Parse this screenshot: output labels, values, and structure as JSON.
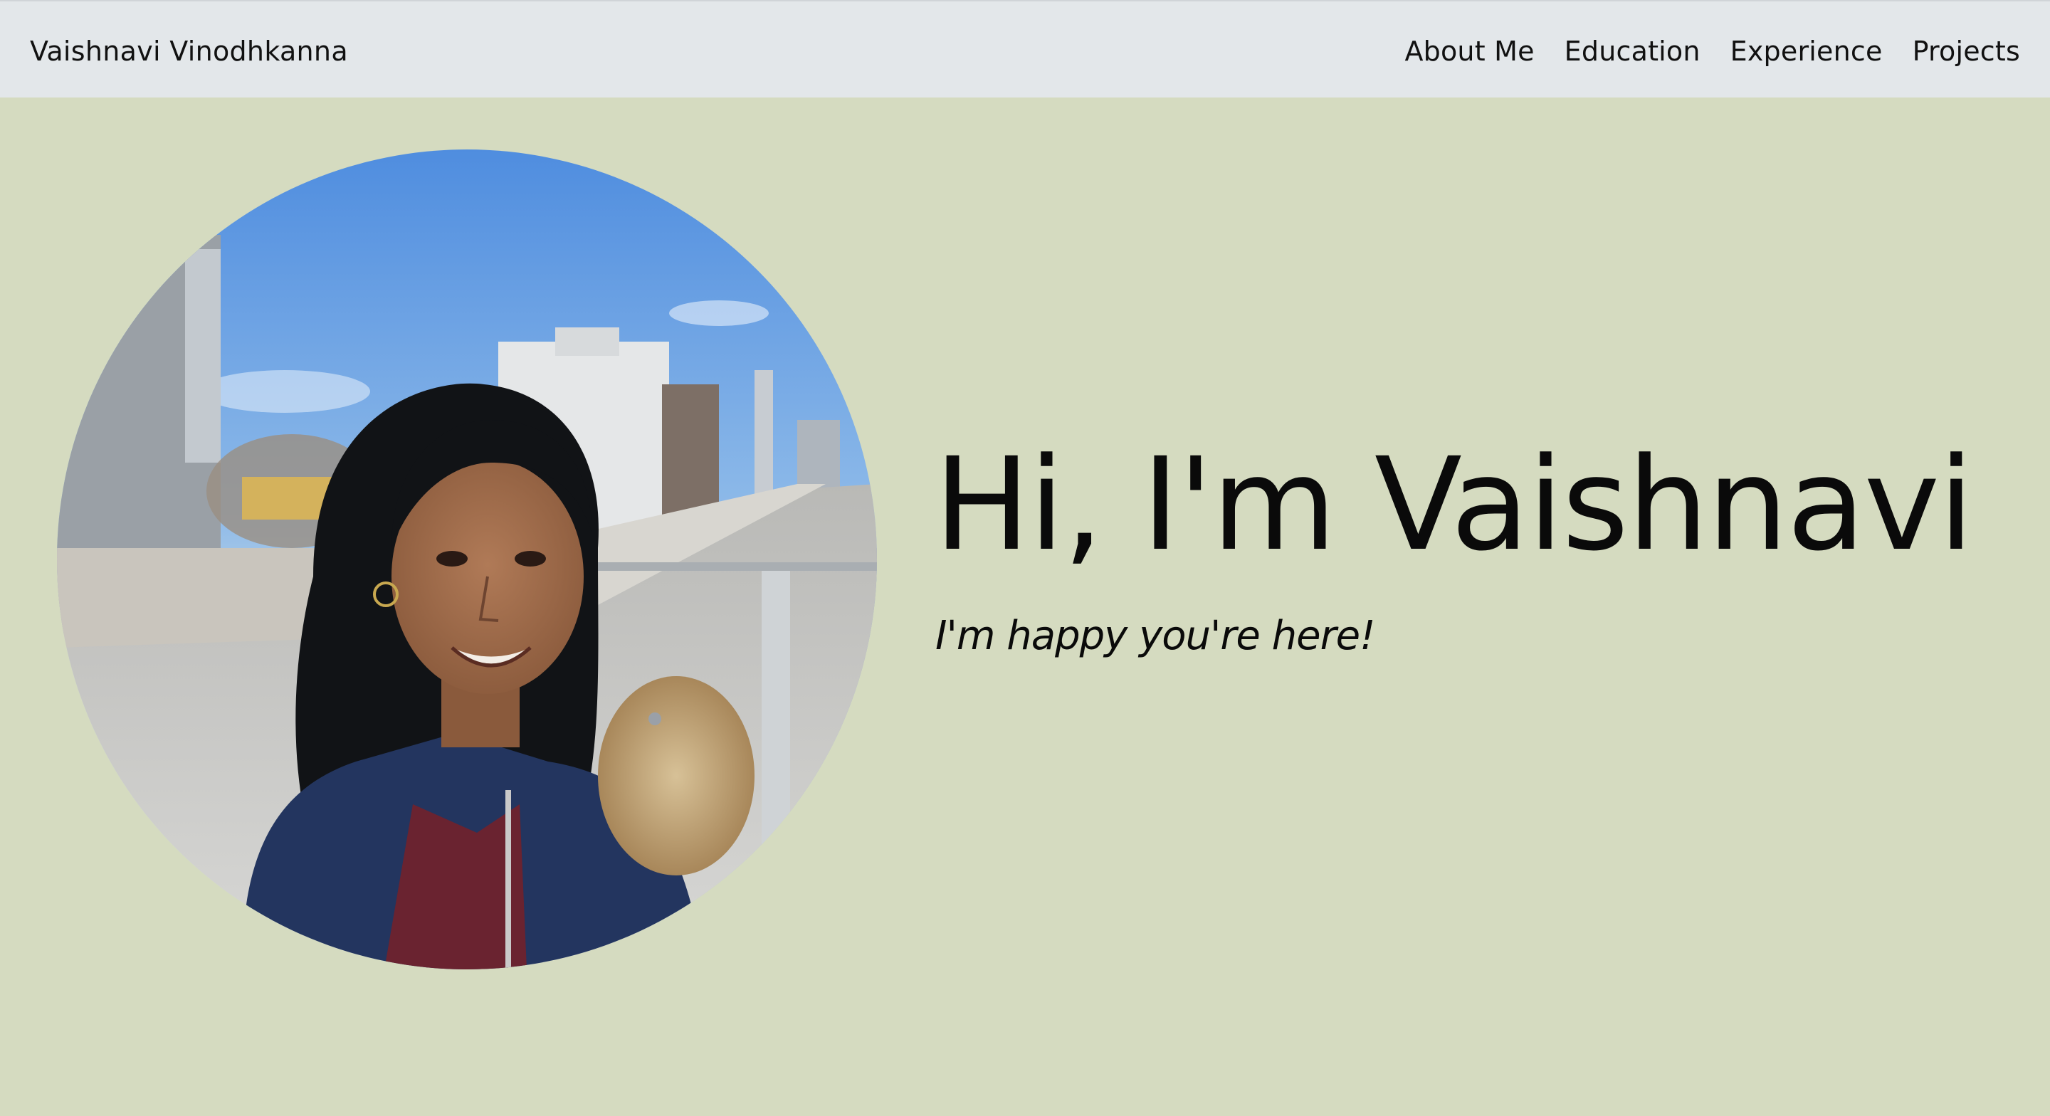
{
  "navbar": {
    "brand": "Vaishnavi Vinodhkanna",
    "links": [
      {
        "label": "About Me"
      },
      {
        "label": "Education"
      },
      {
        "label": "Experience"
      },
      {
        "label": "Projects"
      }
    ]
  },
  "hero": {
    "title": "Hi, I'm Vaishnavi",
    "subtitle": "I'm happy you're here!"
  },
  "colors": {
    "page_background": "#d5dbc0",
    "navbar_background": "#e3e7ea",
    "text": "#0a0a0a"
  }
}
